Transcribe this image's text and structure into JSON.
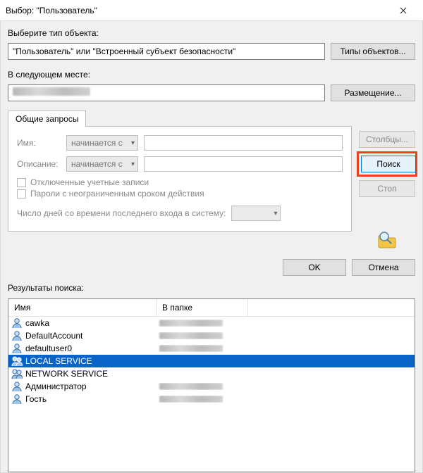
{
  "title": "Выбор: \"Пользователь\"",
  "objectType": {
    "label": "Выберите тип объекта:",
    "value": "\"Пользователь\" или \"Встроенный субъект безопасности\"",
    "button": "Типы объектов..."
  },
  "location": {
    "label": "В следующем месте:",
    "button": "Размещение..."
  },
  "tab": {
    "label": "Общие запросы",
    "name": {
      "label": "Имя:",
      "combo": "начинается с"
    },
    "desc": {
      "label": "Описание:",
      "combo": "начинается с"
    },
    "chkDisabled": "Отключенные учетные записи",
    "chkNoExpire": "Пароли с неограниченным сроком действия",
    "daysLabel": "Число дней со времени последнего входа в систему:"
  },
  "sideButtons": {
    "columns": "Столбцы...",
    "search": "Поиск",
    "stop": "Стоп"
  },
  "ok": "OK",
  "cancel": "Отмена",
  "results": {
    "label": "Результаты поиска:",
    "colName": "Имя",
    "colFolder": "В папке",
    "rows": [
      {
        "name": "cawka",
        "icon": "user",
        "selected": false,
        "folderBlurred": true
      },
      {
        "name": "DefaultAccount",
        "icon": "user",
        "selected": false,
        "folderBlurred": true
      },
      {
        "name": "defaultuser0",
        "icon": "user",
        "selected": false,
        "folderBlurred": true
      },
      {
        "name": "LOCAL SERVICE",
        "icon": "group",
        "selected": true,
        "folderBlurred": false
      },
      {
        "name": "NETWORK SERVICE",
        "icon": "group",
        "selected": false,
        "folderBlurred": false
      },
      {
        "name": "Администратор",
        "icon": "user",
        "selected": false,
        "folderBlurred": true
      },
      {
        "name": "Гость",
        "icon": "user",
        "selected": false,
        "folderBlurred": true
      }
    ]
  }
}
